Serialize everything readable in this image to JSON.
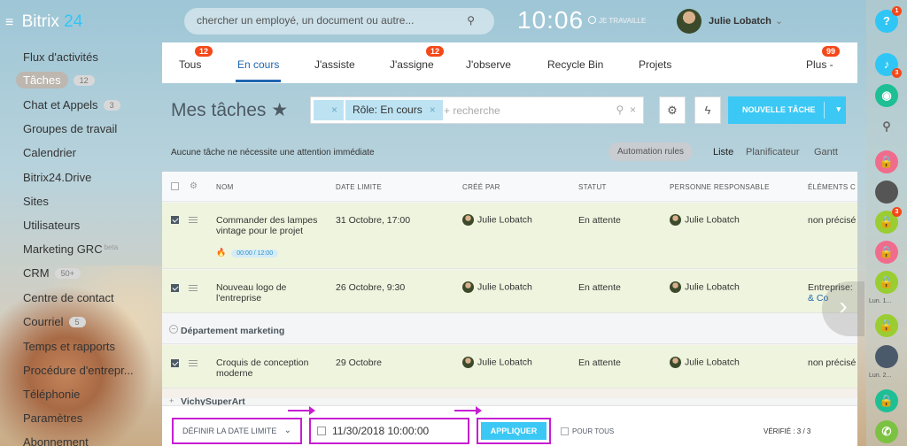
{
  "header": {
    "logo_text": "Bitrix",
    "logo_num": "24",
    "search_placeholder": "chercher un employé, un document ou autre...",
    "clock": "10:06",
    "work_status": "JE TRAVAILLE",
    "user_name": "Julie Lobatch"
  },
  "sidebar": {
    "items": [
      {
        "label": "Flux d'activités"
      },
      {
        "label": "Tâches",
        "badge": "12"
      },
      {
        "label": "Chat et Appels",
        "badge": "3"
      },
      {
        "label": "Groupes de travail"
      },
      {
        "label": "Calendrier"
      },
      {
        "label": "Bitrix24.Drive"
      },
      {
        "label": "Sites"
      },
      {
        "label": "Utilisateurs"
      },
      {
        "label": "Marketing GRC",
        "sup": "beta"
      },
      {
        "label": "CRM",
        "badge": "50+"
      },
      {
        "label": "Centre de contact"
      },
      {
        "label": "Courriel",
        "badge": "5"
      },
      {
        "label": "Temps et rapports"
      },
      {
        "label": "Procédure d'entrepr..."
      },
      {
        "label": "Téléphonie"
      },
      {
        "label": "Paramètres"
      },
      {
        "label": "Abonnement"
      }
    ]
  },
  "tabs": [
    {
      "label": "Tous",
      "counter": "12"
    },
    {
      "label": "En cours"
    },
    {
      "label": "J'assiste"
    },
    {
      "label": "J'assigne",
      "counter": "12"
    },
    {
      "label": "J'observe"
    },
    {
      "label": "Recycle Bin"
    },
    {
      "label": "Projets"
    },
    {
      "label": "Plus -",
      "counter": "99"
    }
  ],
  "toolbar": {
    "title": "Mes tâches ★",
    "filter_chip_empty_x": "×",
    "filter_chip": "Rôle: En cours",
    "filter_chip_x": "×",
    "filter_placeholder": "+ recherche",
    "new_task": "NOUVELLE TÂCHE"
  },
  "notice": "Aucune tâche ne nécessite une attention immédiate",
  "views": {
    "automation": "Automation rules",
    "list": "Liste",
    "planner": "Planificateur",
    "gantt": "Gantt"
  },
  "columns": [
    "NOM",
    "DATE LIMITE",
    "CRÉÉ PAR",
    "STATUT",
    "PERSONNE RESPONSABLE",
    "ÉLÉMENTS C"
  ],
  "rows": [
    {
      "name": "Commander des lampes vintage pour le projet",
      "deadline": "31 Octobre, 17:00",
      "creator": "Julie Lobatch",
      "status": "En attente",
      "responsible": "Julie Lobatch",
      "elements": "non précisé",
      "timer": "00:00 / 12:00"
    },
    {
      "name": "Nouveau logo de l'entreprise",
      "deadline": "26 Octobre, 9:30",
      "creator": "Julie Lobatch",
      "status": "En attente",
      "responsible": "Julie Lobatch",
      "elements": "Entreprise:",
      "elements_link": "& Co"
    },
    {
      "name": "Croquis de conception moderne",
      "deadline": "29 Octobre",
      "creator": "Julie Lobatch",
      "status": "En attente",
      "responsible": "Julie Lobatch",
      "elements": "non précisé"
    }
  ],
  "groups": {
    "marketing": "Département marketing",
    "vichy": "VichySuperArt"
  },
  "bottom": {
    "define_deadline": "DÉFINIR LA DATE LIMITE",
    "date_value": "11/30/2018 10:00:00",
    "apply": "APPLIQUER",
    "for_all": "POUR TOUS",
    "checked": "VÉRIFIÉ : 3 / 3"
  },
  "right_panel": {
    "help_counter": "1",
    "notif_counter": "3",
    "chat_counter": "3",
    "label1": "Lun. 1...",
    "label2": "Lun. 2..."
  },
  "colors": {
    "accent": "#2067b0",
    "button": "#3bc8f5",
    "highlight": "#c61fd2",
    "counter": "#f54819",
    "row_bg": "#eef4db"
  }
}
